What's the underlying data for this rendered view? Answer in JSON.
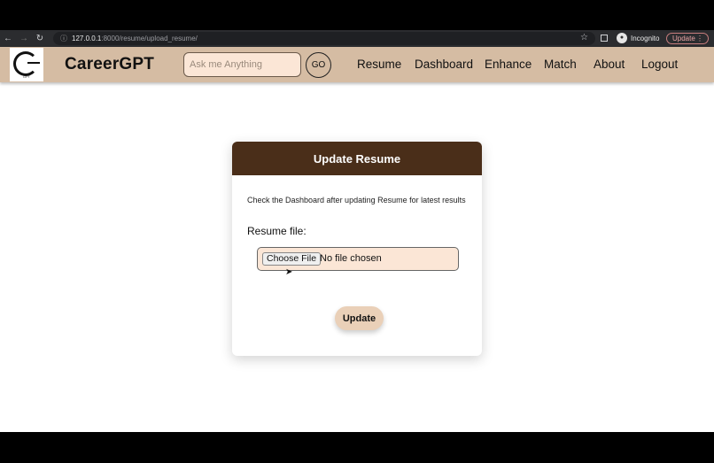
{
  "browser": {
    "url_host": "127.0.0.1",
    "url_path": ":8000/resume/upload_resume/",
    "incognito_label": "Incognito",
    "update_label": "Update",
    "icons": [
      "back-arrow-icon",
      "forward-arrow-icon",
      "reload-icon",
      "info-icon",
      "star-icon",
      "side-panel-icon",
      "incognito-icon",
      "kebab-menu-icon"
    ]
  },
  "navbar": {
    "logo_text": "GPT",
    "brand": "CareerGPT",
    "search_placeholder": "Ask me Anything",
    "go_label": "GO",
    "links": [
      "Resume",
      "Dashboard",
      "Enhance",
      "Match",
      "About",
      "Logout"
    ],
    "background": "#d5bca3"
  },
  "card": {
    "title": "Update Resume",
    "note": "Check the Dashboard after updating Resume for latest results",
    "file_label": "Resume file:",
    "choose_label": "Choose File",
    "file_status": "No file chosen",
    "submit_label": "Update",
    "header_color": "#4a2e19"
  }
}
